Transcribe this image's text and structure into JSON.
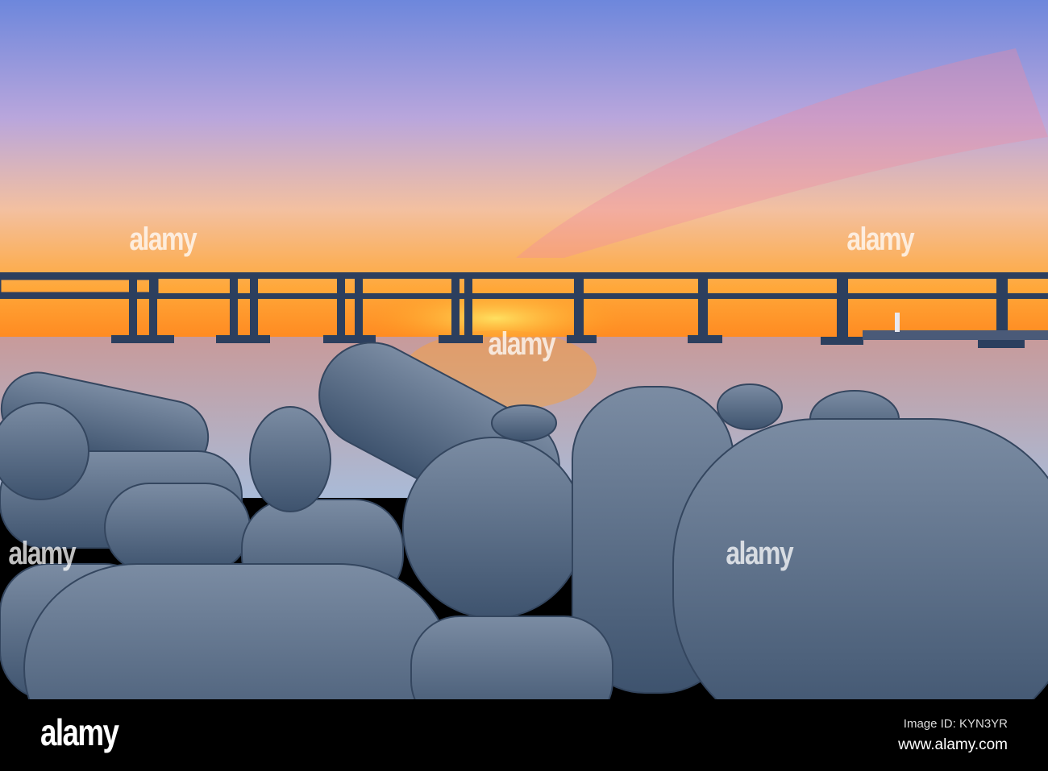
{
  "footer": {
    "logo": "alamy",
    "image_id": "Image ID: KYN3YR",
    "website": "www.alamy.com"
  },
  "watermark": "alamy",
  "colors": {
    "sky_top": "#6f86d8",
    "sky_mid": "#c8a7d6",
    "horizon": "#ff9a1a",
    "sea": "#a7b4cf",
    "rock": "#5f7590"
  }
}
